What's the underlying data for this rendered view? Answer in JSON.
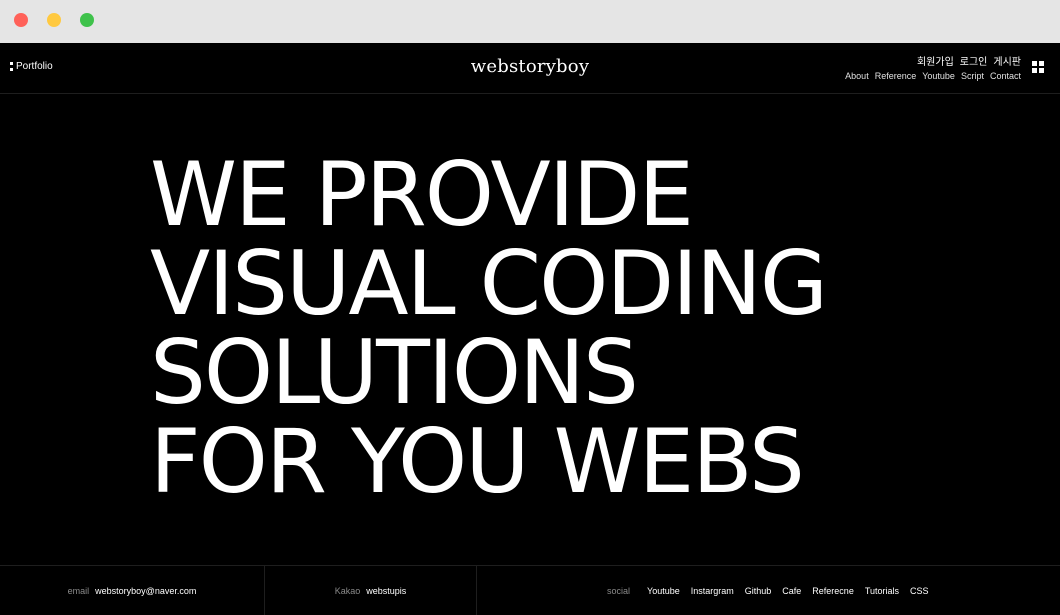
{
  "header": {
    "portfolio_label": "Portfolio",
    "logo": "webstoryboy",
    "member_links": [
      "회원가입",
      "로그인",
      "게시판"
    ],
    "nav_links": [
      "About",
      "Reference",
      "Youtube",
      "Script",
      "Contact"
    ]
  },
  "hero": {
    "lines": [
      "WE PROVIDE",
      "VISUAL CODING",
      "SOLUTIONS",
      "FOR YOU WEBS"
    ]
  },
  "footer": {
    "email_label": "email",
    "email_value": "webstoryboy@naver.com",
    "kakao_label": "Kakao",
    "kakao_value": "webstupis",
    "social_label": "social",
    "social_links": [
      "Youtube",
      "Instargram",
      "Github",
      "Cafe",
      "Referecne",
      "Tutorials",
      "CSS"
    ]
  },
  "colors": {
    "background": "#000000",
    "text": "#ffffff",
    "muted": "#8a8a8a",
    "close_dot": "#ff6159",
    "minimize_dot": "#ffc940",
    "maximize_dot": "#3fc24b"
  },
  "icons": [
    "close-dot-icon",
    "minimize-dot-icon",
    "maximize-dot-icon",
    "portfolio-dots-icon",
    "grid-menu-icon"
  ]
}
